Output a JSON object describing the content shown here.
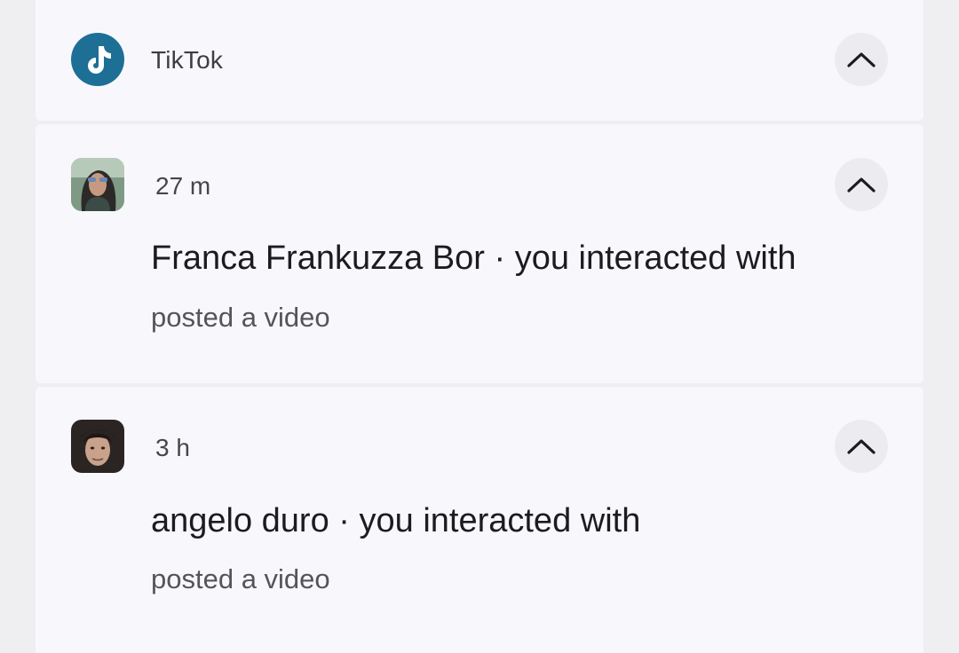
{
  "app": {
    "name": "TikTok",
    "icon": "tiktok-logo-icon",
    "icon_color": "#1d6f95"
  },
  "notifications": [
    {
      "time": "27 m",
      "title": "Franca Frankuzza Bor · you interacted with",
      "body": "posted a video",
      "avatar": "avatar-woman-sunglasses"
    },
    {
      "time": "3 h",
      "title": "angelo duro · you interacted with",
      "body": "posted a video",
      "avatar": "avatar-man-portrait"
    }
  ],
  "icons": {
    "collapse": "chevron-up-icon"
  }
}
